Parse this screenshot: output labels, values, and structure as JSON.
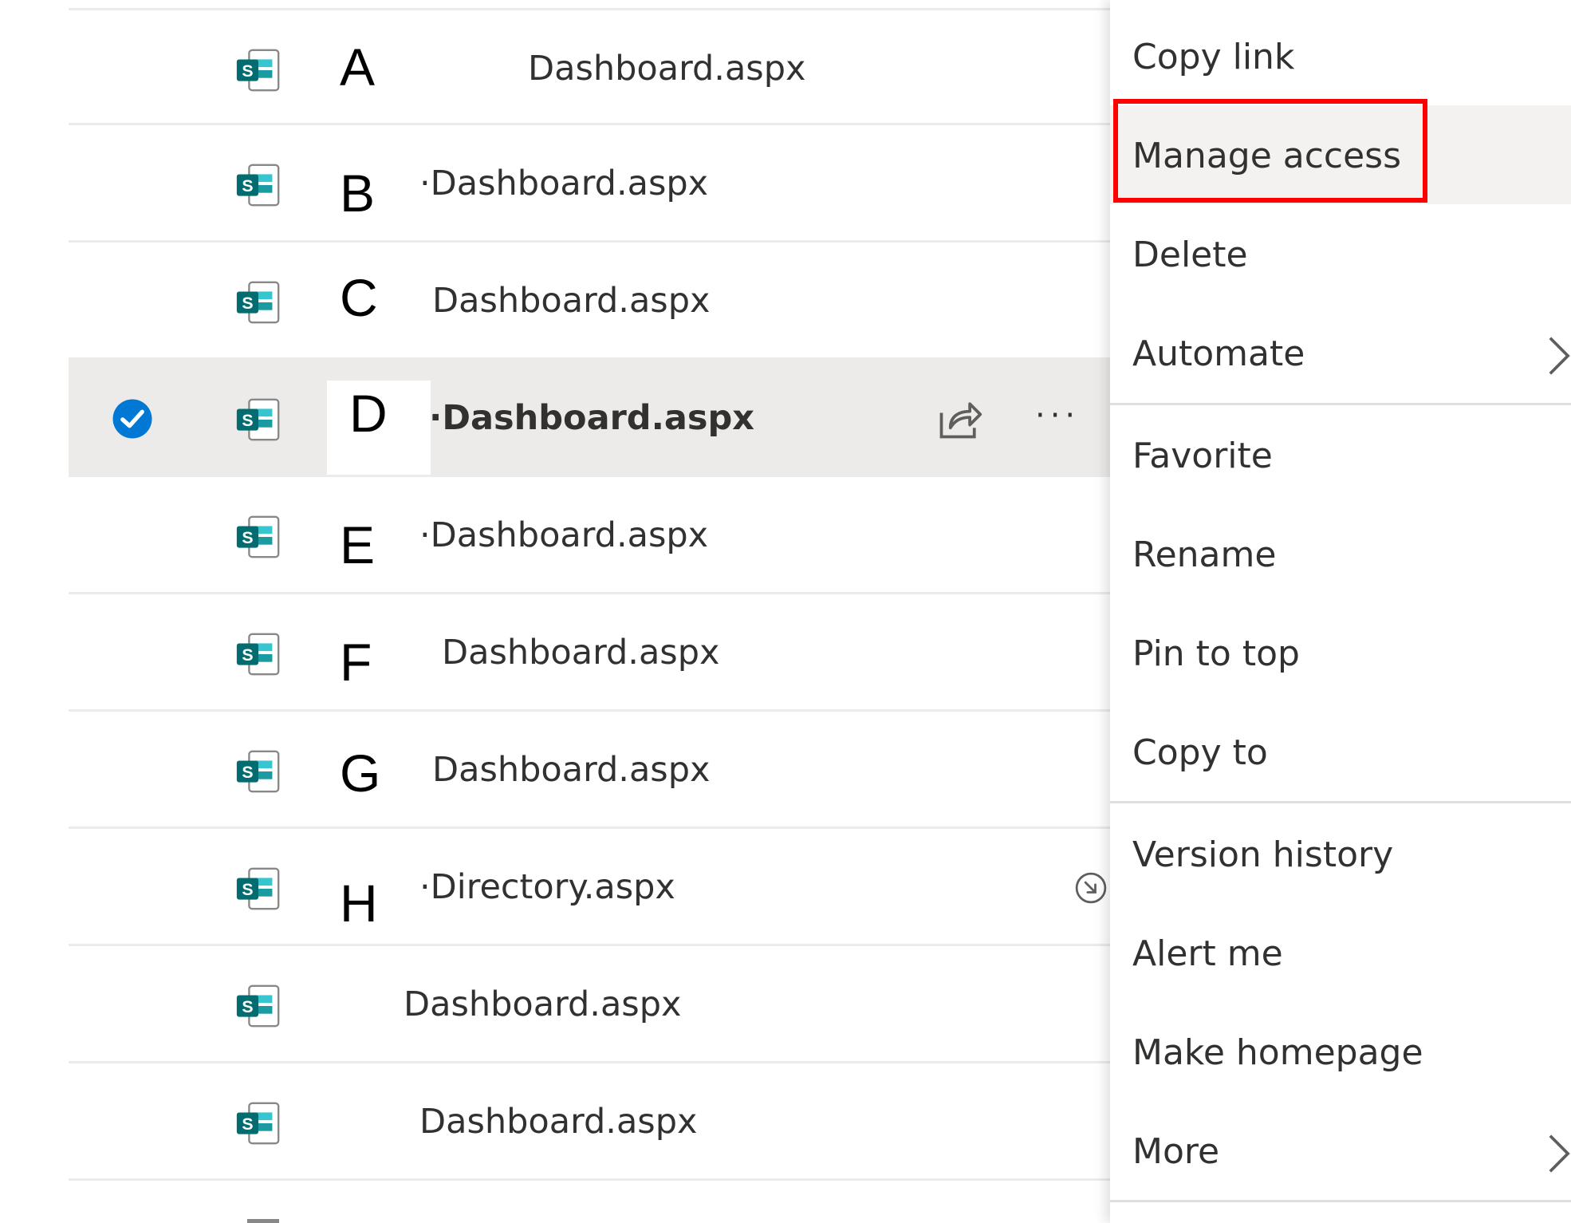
{
  "files": [
    {
      "letter": "A",
      "name": "Dashboard.aspx"
    },
    {
      "letter": "B",
      "name": "·Dashboard.aspx"
    },
    {
      "letter": "C",
      "name": "Dashboard.aspx"
    },
    {
      "letter": "D",
      "name": "·Dashboard.aspx",
      "selected": true
    },
    {
      "letter": "E",
      "name": "·Dashboard.aspx"
    },
    {
      "letter": "F",
      "name": "Dashboard.aspx"
    },
    {
      "letter": "G",
      "name": "Dashboard.aspx"
    },
    {
      "letter": "H",
      "name": "·Directory.aspx"
    },
    {
      "letter": "",
      "name": "Dashboard.aspx"
    },
    {
      "letter": "",
      "name": "Dashboard.aspx"
    }
  ],
  "row_actions": {
    "more_label": "···"
  },
  "icons": {
    "file": "sharepoint-page-icon",
    "check": "check-circle-icon",
    "share": "share-icon",
    "sync": "sync-arrow-icon",
    "chevron": "chevron-right-icon"
  },
  "menu": {
    "items": [
      {
        "label": "Copy link"
      },
      {
        "label": "Manage access",
        "highlighted": true
      },
      {
        "label": "Delete"
      },
      {
        "label": "Automate",
        "submenu": true
      },
      {
        "label": "Favorite"
      },
      {
        "label": "Rename"
      },
      {
        "label": "Pin to top"
      },
      {
        "label": "Copy to"
      },
      {
        "label": "Version history"
      },
      {
        "label": "Alert me"
      },
      {
        "label": "Make homepage"
      },
      {
        "label": "More",
        "submenu": true
      }
    ]
  },
  "colors": {
    "accent": "#0078d4",
    "sharepoint_teal": "#036c70",
    "highlight_border": "#ff0000",
    "selected_row": "#edebe9"
  }
}
